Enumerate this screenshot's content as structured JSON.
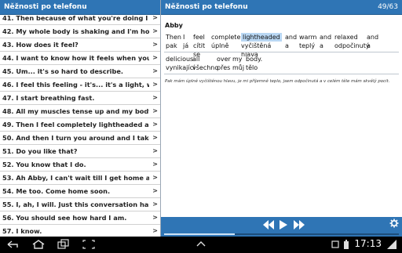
{
  "left_panel": {
    "title": "Něžnosti po telefonu",
    "items": [
      "41. Then because of what you're doing I have an incr...",
      "42. My whole body is shaking and I'm holding on to ...",
      "43. How does it feel?",
      "44. I want to know how it feels when you have an or...",
      "45. Um... it's so hard to describe.",
      "46. I feel this feeling - it's... it's a light, warm feeling...",
      "47. I start breathing fast.",
      "48. All my muscles tense up and my body starts sha...",
      "49. Then I feel completely lightheaded and warm an...",
      "50. And then I turn you around and I take you from ...",
      "51. Do you like that?",
      "52. You know that I do.",
      "53. Ah Abby, I can't wait till I get home and then I ca...",
      "54. Me too. Come home soon.",
      "55. I, ah, I will. Just this conversation has made me cr...",
      "56. You should see how hard I am.",
      "57. I know.",
      "58. I know, but I better go..."
    ]
  },
  "right_panel": {
    "title": "Něžnosti po telefonu",
    "counter": "49/63",
    "speaker": "Abby",
    "line1": [
      {
        "en": "Then",
        "cs": "pak"
      },
      {
        "en": "I",
        "cs": "já"
      },
      {
        "en": "feel",
        "cs": "cítit se"
      },
      {
        "en": "completely",
        "cs": "úplně"
      },
      {
        "en": "lightheaded",
        "cs": "vyčištěná hlava"
      },
      {
        "en": "and",
        "cs": "a"
      },
      {
        "en": "warm",
        "cs": "teplý"
      },
      {
        "en": "and",
        "cs": "a"
      },
      {
        "en": "relaxed",
        "cs": "odpočinutý"
      },
      {
        "en": "and",
        "cs": "a"
      }
    ],
    "line2": [
      {
        "en": "delicious",
        "cs": "vynikající"
      },
      {
        "en": "all",
        "cs": "všechno"
      },
      {
        "en": "over",
        "cs": "přes"
      },
      {
        "en": "my",
        "cs": "můj"
      },
      {
        "en": "body.",
        "cs": "tělo"
      }
    ],
    "translation": "Pak mám úplně vyčištěnou hlavu, je mi příjemně teplo, jsem odpočinutá a v celém těle mám skvělý pocit.",
    "highlighted_word": "lightheaded"
  },
  "player": {
    "progress": 0.3,
    "controls": [
      "rewind-icon",
      "play-icon",
      "forward-icon"
    ]
  },
  "system_bar": {
    "time": "17:13",
    "icons": [
      "back-icon",
      "home-icon",
      "recent-apps-icon",
      "screenshot-icon",
      "menu-icon",
      "battery-icon",
      "signal-icon"
    ]
  },
  "colors": {
    "header_blue": "#2f75b5",
    "highlight": "#b9d7f3"
  }
}
